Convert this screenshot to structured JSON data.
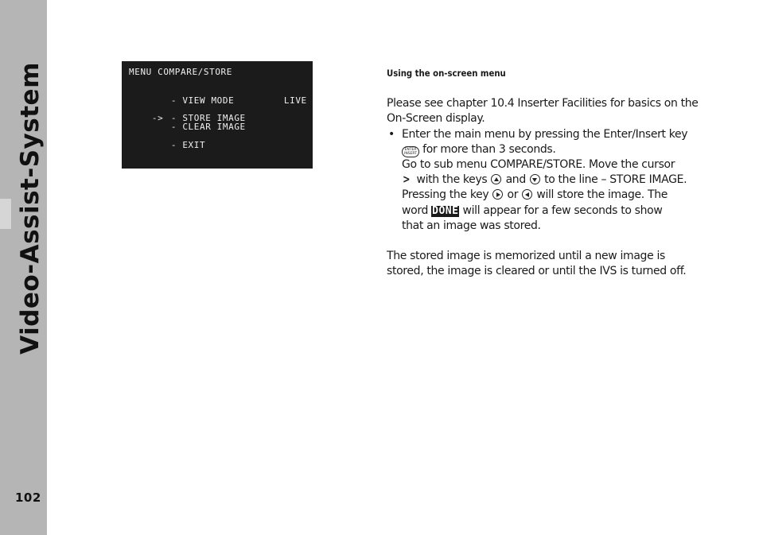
{
  "sidebar": {
    "title": "Video-Assist-System",
    "page_number": "102",
    "colors": {
      "background": "#b5b5b6",
      "tab": "#d6d6d7"
    }
  },
  "osd_menu": {
    "background": "#1b1b1b",
    "title": "MENU COMPARE/STORE",
    "items": [
      {
        "cursor": "",
        "label": "- VIEW MODE",
        "value": "LIVE"
      },
      {
        "cursor": "->",
        "label": "- STORE IMAGE",
        "value": ""
      },
      {
        "cursor": "",
        "label": "- CLEAR IMAGE",
        "value": ""
      },
      {
        "cursor": "",
        "label": "- EXIT",
        "value": ""
      }
    ]
  },
  "content": {
    "heading": "Using the on-screen menu",
    "intro": "Please see chapter 10.4 Inserter Facilities for basics on the On-Screen display.",
    "bullet_symbol": "•",
    "bullet": {
      "l1": "Enter the main menu by pressing the Enter/Insert key",
      "enter_key_top": "ENTER",
      "enter_key_bottom": "INSERT",
      "l2": "for more than 3 seconds.",
      "l3": "Go to sub menu COMPARE/STORE. Move the cursor",
      "cursor_glyph": ">",
      "l4a": "with the keys",
      "l4b": "and",
      "l4c": "to the line – STORE IMAGE.",
      "l5a": "Pressing the key",
      "l5b": "or",
      "l5c": "will store the image. The",
      "l6a": "word",
      "done_word": "DONE",
      "l6b": "will appear for a few seconds to show",
      "l7": "that an image was stored."
    },
    "closing": "The stored image is memorized until a new image is stored, the image is cleared or until the IVS is turned off."
  }
}
